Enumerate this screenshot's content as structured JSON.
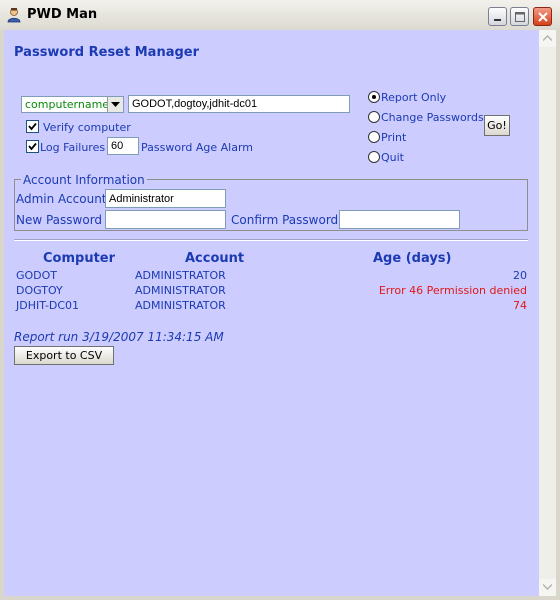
{
  "window": {
    "title": "PWD Man"
  },
  "heading": "Password Reset Manager",
  "controls": {
    "target_type": "computername",
    "computers": "GODOT,dogtoy,jdhit-dc01",
    "verify_label": "Verify computer",
    "verify_checked": true,
    "log_label": "Log Failures",
    "log_checked": true,
    "age_alarm_value": "60",
    "age_alarm_label": "Password Age Alarm",
    "go_label": "Go!"
  },
  "mode": {
    "options": [
      "Report Only",
      "Change Passwords",
      "Print",
      "Quit"
    ],
    "selected": "Report Only"
  },
  "account_info": {
    "legend": "Account Information",
    "admin_label": "Admin Account",
    "admin_value": "Administrator",
    "new_password_label": "New Password",
    "new_password_value": "",
    "confirm_password_label": "Confirm Password",
    "confirm_password_value": ""
  },
  "results": {
    "headers": [
      "Computer",
      "Account",
      "Age (days)"
    ],
    "rows": [
      {
        "computer": "GODOT",
        "account": "ADMINISTRATOR",
        "age": "20",
        "error": false
      },
      {
        "computer": "DOGTOY",
        "account": "ADMINISTRATOR",
        "age": "Error 46 Permission denied",
        "error": true
      },
      {
        "computer": "JDHIT-DC01",
        "account": "ADMINISTRATOR",
        "age": "74",
        "error": false
      }
    ]
  },
  "report_run": "Report run 3/19/2007 11:34:15 AM",
  "export_label": "Export to CSV",
  "colors": {
    "background": "#CCCCFF",
    "label": "#1C3BB3",
    "error": "#E01818",
    "select_text": "#0B8A0B"
  },
  "icons": [
    "user-icon",
    "minimize-icon",
    "maximize-icon",
    "close-icon",
    "chevron-down-icon",
    "checkmark-icon",
    "scroll-up-icon",
    "scroll-down-icon"
  ]
}
